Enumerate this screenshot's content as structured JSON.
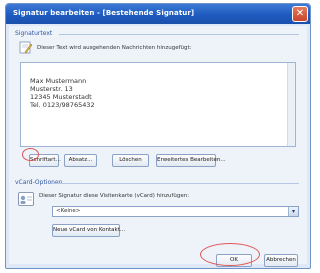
{
  "window": {
    "title": "Signatur bearbeiten - [Bestehende Signatur]",
    "close_glyph": "✕"
  },
  "signature_group": {
    "title": "Signaturtext",
    "hint": "Dieser Text wird ausgehenden Nachrichten hinzugefügt:",
    "icon": "signature-pen-icon"
  },
  "signature_text": {
    "lines": [
      "Max Mustermann",
      "Musterstr. 13",
      "12345 Musterstadt",
      "Tel. 0123/98765432"
    ]
  },
  "buttons": {
    "schriftart": "Schriftart...",
    "absatz": "Absatz...",
    "loeschen": "Löschen",
    "erweitertes": "Erweitertes Bearbeiten..."
  },
  "vcard_group": {
    "title": "vCard-Optionen",
    "hint": "Dieser Signatur diese Visitenkarte (vCard) hinzufügen:",
    "icon": "vcard-icon",
    "selected_value": "<Keine>",
    "new_vcard_button": "Neue vCard von Kontakt..."
  },
  "footer": {
    "ok": "OK",
    "cancel": "Abbrechen"
  },
  "annotation_color": "#e05555"
}
